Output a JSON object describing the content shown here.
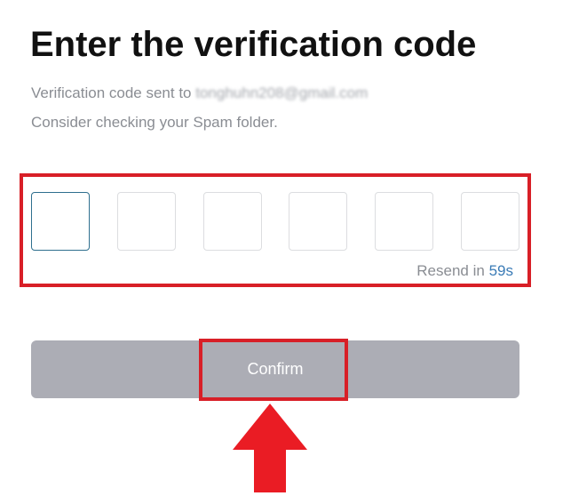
{
  "header": {
    "title": "Enter the verification code",
    "sent_to_label": "Verification code sent to",
    "email": "tonghuhn208@gmail.com",
    "spam_hint": "Consider checking your Spam folder."
  },
  "code_input": {
    "digits": [
      "",
      "",
      "",
      "",
      "",
      ""
    ],
    "resend_label": "Resend in",
    "resend_countdown": "59s"
  },
  "actions": {
    "confirm_label": "Confirm"
  },
  "colors": {
    "highlight": "#d81f27",
    "button_disabled": "#acadb5",
    "link": "#3a7bb6",
    "active_border": "#2f6f8e"
  },
  "annotations": {
    "arrow": "up-arrow-icon"
  }
}
